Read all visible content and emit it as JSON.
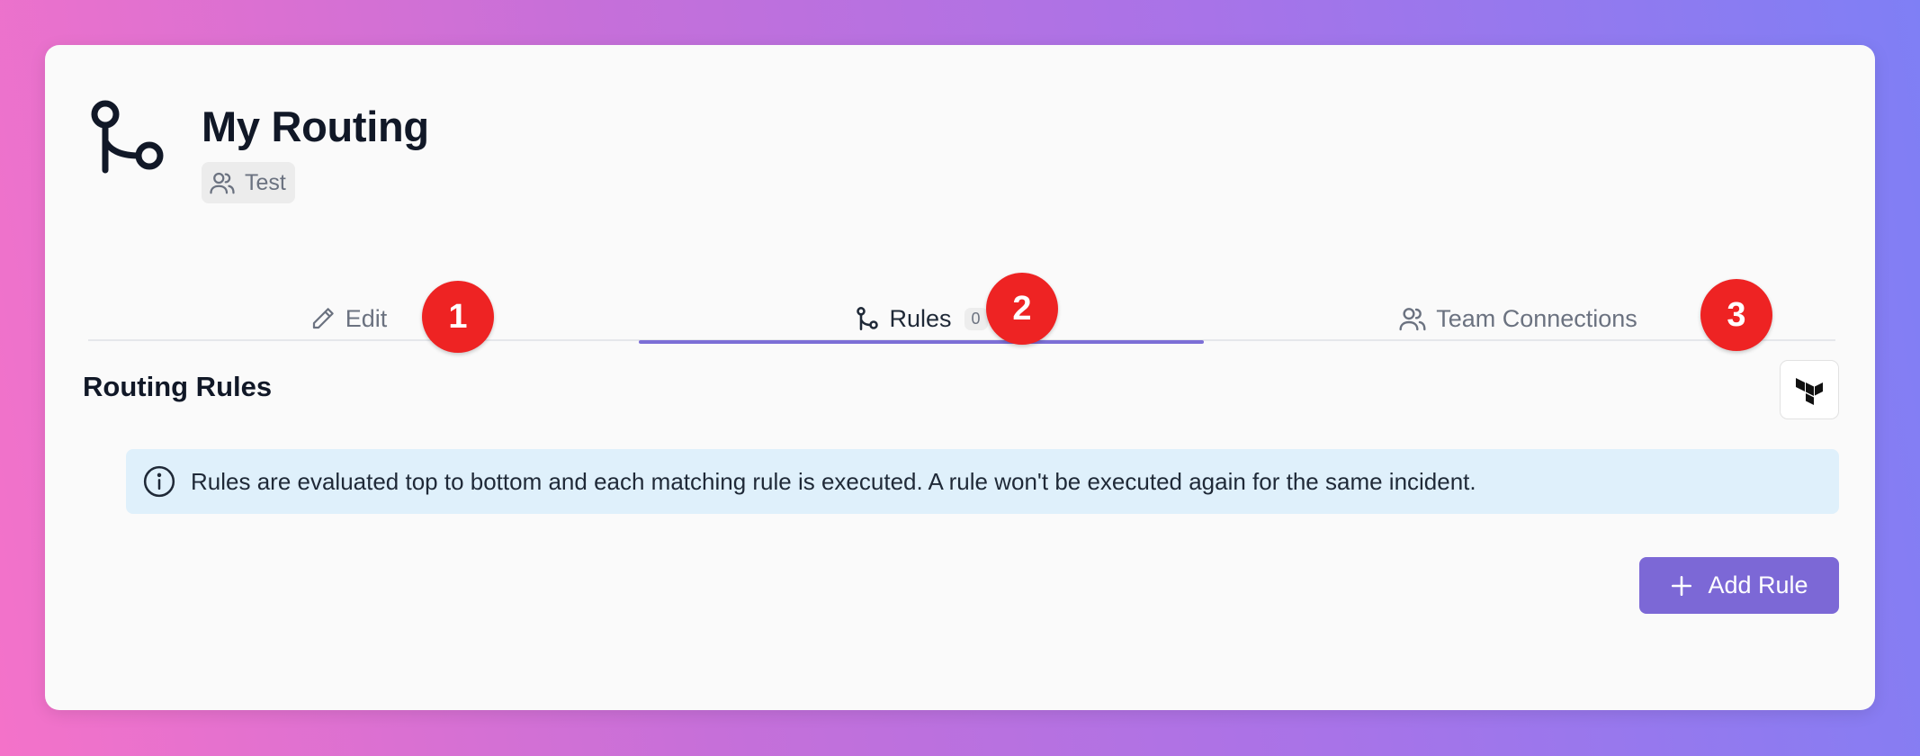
{
  "header": {
    "title": "My Routing",
    "team_chip_label": "Test",
    "icon": "route-icon"
  },
  "tabs": [
    {
      "label": "Edit",
      "icon": "pencil-icon",
      "active": false
    },
    {
      "label": "Rules",
      "icon": "route-icon",
      "count": "0",
      "active": true
    },
    {
      "label": "Team Connections",
      "icon": "users-icon",
      "active": false
    }
  ],
  "annotations": [
    "1",
    "2",
    "3"
  ],
  "section": {
    "title": "Routing Rules",
    "terraform_button_icon": "terraform-icon"
  },
  "info": {
    "icon": "info-icon",
    "text": "Rules are evaluated top to bottom and each matching rule is executed. A rule won't be executed again for the same incident."
  },
  "actions": {
    "add_rule_label": "Add Rule",
    "add_rule_icon": "plus-icon"
  },
  "colors": {
    "accent": "#7c68d6",
    "marker": "#ee2323",
    "info_bg": "#dff0fb",
    "card_bg": "#fafafa"
  }
}
